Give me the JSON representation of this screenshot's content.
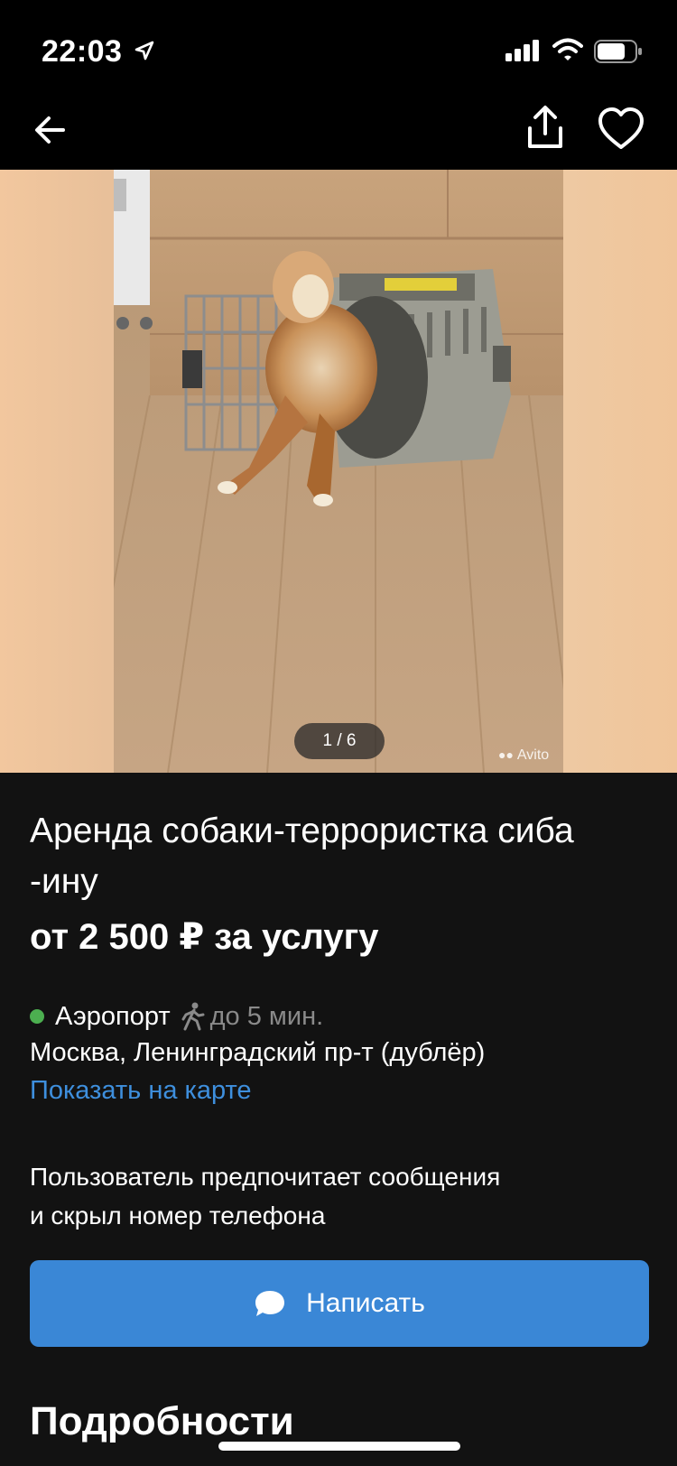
{
  "status_bar": {
    "time": "22:03",
    "icons": [
      "location-arrow-icon",
      "cellular-signal-icon",
      "wifi-icon",
      "battery-icon"
    ]
  },
  "nav": {
    "icons": [
      "back-arrow-icon",
      "share-icon",
      "heart-icon"
    ]
  },
  "gallery": {
    "counter": "1 / 6",
    "watermark": "Avito"
  },
  "listing": {
    "title_line1": "Аренда собаки-террористка сиба",
    "title_line2": "-ину",
    "price": "от 2 500 ₽ за услугу",
    "metro_station": "Аэропорт",
    "metro_time": "до 5 мин.",
    "address": "Москва, Ленинградский пр-т (дублёр)",
    "map_link": "Показать на карте",
    "notice_line1": "Пользователь предпочитает сообщения",
    "notice_line2": "и скрыл номер телефона",
    "write_button": "Написать",
    "details_heading": "Подробности"
  },
  "colors": {
    "background": "#121212",
    "bar_background": "#000000",
    "accent_blue": "#3a87d6",
    "link_blue": "#3e8fdd",
    "metro_green": "#4caf50",
    "muted_text": "#8a8a8a"
  }
}
